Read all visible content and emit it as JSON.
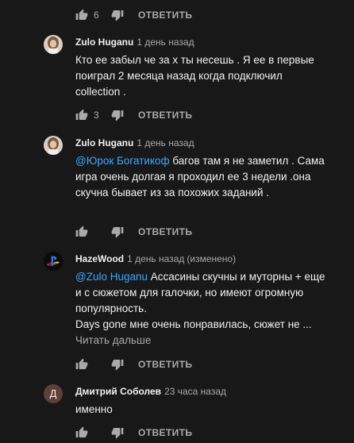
{
  "reply_label": "ОТВЕТИТЬ",
  "top_actions": {
    "likes": "6"
  },
  "comments": [
    {
      "author": "Zulo Huganu",
      "time": "1 день назад",
      "text": "Кто ее забыл че за х ты несешь . Я ее в первые поиграл 2 месяца назад когда подключил collection .",
      "likes": "3"
    },
    {
      "author": "Zulo Huganu",
      "time": "1 день назад",
      "mention": "@Юрок Богатикоф",
      "text": " багов там я не заметил . Сама игра очень долгая я проходил ее 3 недели .она скучна бывает из за похожих заданий .",
      "likes": ""
    },
    {
      "author": "HazeWood",
      "time": "1 день назад",
      "edited": "(изменено)",
      "mention": "@Zulo Huganu",
      "text": " Ассасины скучны и муторны + еще и с сюжетом для галочки, но имеют огромную популярность.\nDays gone мне очень понравилась, сюжет не ...",
      "read_more": "Читать дальше",
      "likes": ""
    },
    {
      "author": "Дмитрий Соболев",
      "time": "23 часа назад",
      "avatar_letter": "Д",
      "text": "именно",
      "likes": ""
    }
  ],
  "colors": {
    "background": "#181818",
    "text": "#f1f1f1",
    "secondary": "#aaaaaa",
    "link": "#3ea6ff",
    "avatar_letter_bg": "#5d4037"
  }
}
